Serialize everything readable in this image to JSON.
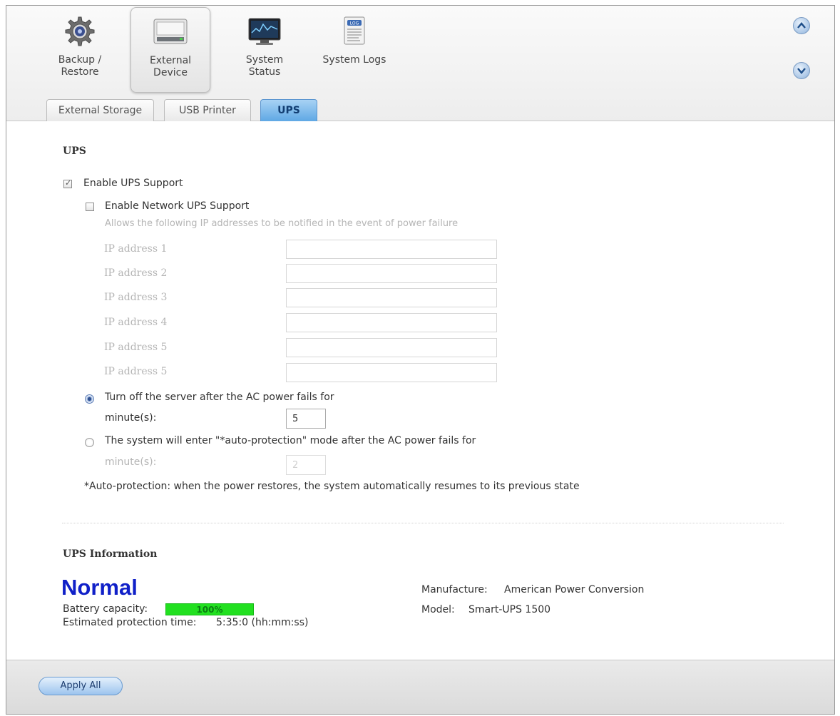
{
  "header": {
    "apps": [
      {
        "label": "Backup /\nRestore",
        "icon": "gear-icon"
      },
      {
        "label": "External\nDevice",
        "icon": "drive-icon"
      },
      {
        "label": "System\nStatus",
        "icon": "monitor-icon"
      },
      {
        "label": "System Logs",
        "icon": "log-icon",
        "icon_text": "LOG"
      }
    ],
    "active_app": "External Device"
  },
  "tabs": [
    {
      "label": "External Storage"
    },
    {
      "label": "USB Printer"
    },
    {
      "label": "UPS"
    }
  ],
  "active_tab": "UPS",
  "ups": {
    "title": "UPS",
    "enable_ups_label": "Enable UPS Support",
    "enable_ups_checked": true,
    "enable_network_label": "Enable Network UPS Support",
    "enable_network_checked": false,
    "network_note": "Allows the following IP addresses to be notified in the event of power failure",
    "ip_labels": [
      "IP address 1",
      "IP address 2",
      "IP address 3",
      "IP address 4",
      "IP address 5",
      "IP address 5"
    ],
    "option1_label": "Turn off the server after the AC power fails for",
    "option1_selected": true,
    "option1_minutes_label": "minute(s):",
    "option1_minutes_value": "5",
    "option2_label": "The system will enter \"*auto-protection\" mode after the AC power fails for",
    "option2_selected": false,
    "option2_minutes_label": "minute(s):",
    "option2_minutes_value": "2",
    "footnote": "*Auto-protection: when the power restores, the system automatically resumes to its previous state"
  },
  "ups_info": {
    "title": "UPS Information",
    "status": "Normal",
    "battery_label": "Battery capacity:",
    "battery_value": "100%",
    "battery_fraction": 1.0,
    "protection_label": "Estimated protection time:",
    "protection_value": "5:35:0 (hh:mm:ss)",
    "manufacture_label": "Manufacture:",
    "manufacture_value": "American Power Conversion",
    "model_label": "Model:",
    "model_value": "Smart-UPS 1500"
  },
  "footer": {
    "apply_label": "Apply All"
  },
  "colors": {
    "status_text": "#1020c8",
    "battery_bar": "#22e020",
    "active_tab": "#5fa8e4"
  }
}
